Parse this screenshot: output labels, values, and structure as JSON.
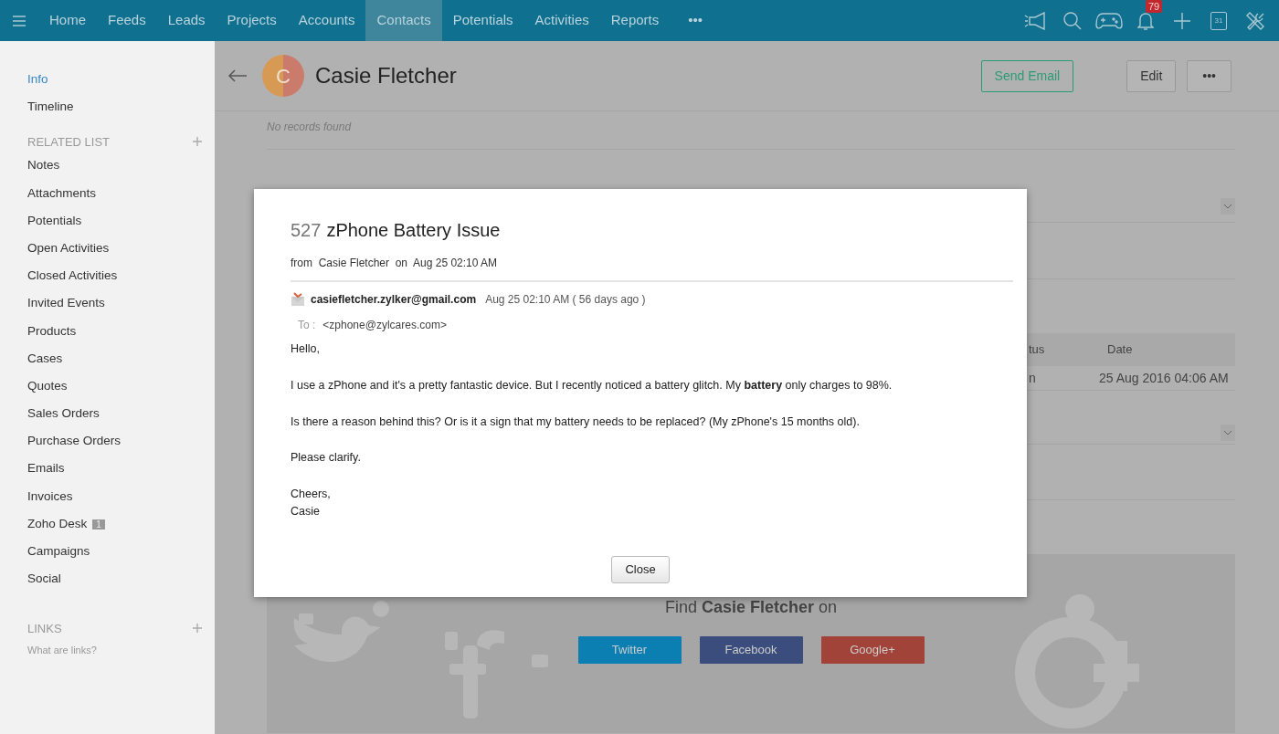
{
  "navbar": {
    "items": [
      {
        "label": "Home",
        "selected": false
      },
      {
        "label": "Feeds",
        "selected": false
      },
      {
        "label": "Leads",
        "selected": false
      },
      {
        "label": "Projects",
        "selected": false
      },
      {
        "label": "Accounts",
        "selected": false
      },
      {
        "label": "Contacts",
        "selected": true
      },
      {
        "label": "Potentials",
        "selected": false
      },
      {
        "label": "Activities",
        "selected": false
      },
      {
        "label": "Reports",
        "selected": false
      }
    ],
    "more": "•••",
    "notifications": "79",
    "calendar_day": "31"
  },
  "sidebar": {
    "items": [
      {
        "label": "Info",
        "selected": true
      },
      {
        "label": "Timeline",
        "selected": false
      }
    ],
    "related_list": {
      "heading": "RELATED LIST",
      "items": [
        {
          "label": "Notes"
        },
        {
          "label": "Attachments"
        },
        {
          "label": "Potentials"
        },
        {
          "label": "Open Activities"
        },
        {
          "label": "Closed Activities"
        },
        {
          "label": "Invited Events"
        },
        {
          "label": "Products"
        },
        {
          "label": "Cases"
        },
        {
          "label": "Quotes"
        },
        {
          "label": "Sales Orders"
        },
        {
          "label": "Purchase Orders"
        },
        {
          "label": "Emails"
        },
        {
          "label": "Invoices"
        },
        {
          "label": "Zoho Desk",
          "badge": "1"
        },
        {
          "label": "Campaigns"
        },
        {
          "label": "Social"
        }
      ]
    },
    "links": {
      "heading": "LINKS",
      "hint": "What are links?"
    }
  },
  "contact": {
    "initial": "C",
    "name": "Casie Fletcher",
    "buttons": [
      "Send Email",
      "Edit",
      "•••"
    ]
  },
  "background": {
    "empty_text": "No records found",
    "table": {
      "columns": [
        "tus",
        "Date"
      ],
      "rows": [
        [
          "n",
          "25 Aug 2016 04:06 AM"
        ]
      ]
    }
  },
  "social": {
    "heading": "Find **Casie Fletcher** on",
    "buttons": [
      {
        "label": "Twitter",
        "color": "#0b7fb1"
      },
      {
        "label": "Facebook",
        "color": "#3a4d7c"
      },
      {
        "label": "Google+",
        "color": "#a2433a"
      }
    ]
  },
  "modal": {
    "number": "527",
    "subject": "zPhone Battery Issue",
    "meta": "from  Casie Fletcher  on  Aug 25 02:10 AM",
    "sender": "casiefletcher.zylker@gmail.com",
    "sent": "Aug 25 02:10 AM ( 56 days ago )",
    "to_label": "To :",
    "to": "<zphone@zylcares.com>",
    "body": [
      "Hello,",
      "I use a zPhone and it's a pretty fantastic device. But I recently noticed a battery glitch. My **battery** only charges to 98%.",
      "Is there a reason behind this? Or is it a sign that my battery needs to be replaced? (My zPhone's 15 months old).",
      "Please clarify.",
      "Cheers,\nCasie"
    ],
    "close": "Close"
  }
}
